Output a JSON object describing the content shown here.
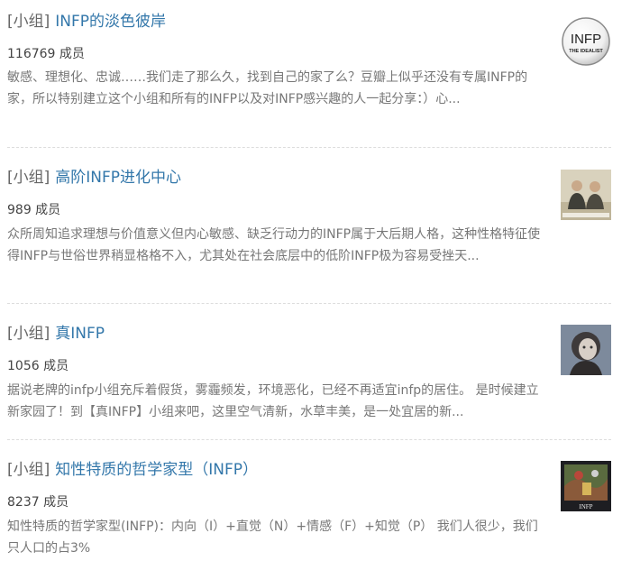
{
  "groups": [
    {
      "tag": "[小组]",
      "name": "INFP的淡色彼岸",
      "members": "116769 成员",
      "description": "敏感、理想化、忠诚……我们走了那么久，找到自己的家了么？豆瓣上似乎还没有专属INFP的家，所以特别建立这个小组和所有的INFP以及对INFP感兴趣的人一起分享：）心...",
      "thumbnail": {
        "icon": "infp-idealist-logo",
        "text_main": "INFP",
        "text_sub": "THE IDEALIST"
      }
    },
    {
      "tag": "[小组]",
      "name": "高阶INFP进化中心",
      "members": "989 成员",
      "description": "众所周知追求理想与价值意义但内心敏感、缺乏行动力的INFP属于大后期人格，这种性格特征使得INFP与世俗世界稍显格格不入，尤其处在社会底层中的低阶INFP极为容易受挫天...",
      "thumbnail": {
        "icon": "two-men-photo"
      }
    },
    {
      "tag": "[小组]",
      "name": "真INFP",
      "members": "1056 成员",
      "description": "据说老牌的infp小组充斥着假货，雾霾频发，环境恶化，已经不再适宜infp的居住。 是时候建立新家园了！到【真INFP】小组来吧，这里空气清新，水草丰美，是一处宜居的新...",
      "thumbnail": {
        "icon": "girl-portrait-photo"
      }
    },
    {
      "tag": "[小组]",
      "name": "知性特质的哲学家型（INFP）",
      "members": "8237 成员",
      "description": "知性特质的哲学家型(INFP)：内向（I）+直觉（N）+情感（F）+知觉（P） 我们人很少，我们只人口的占3%",
      "thumbnail": {
        "icon": "painting-infp-card",
        "caption": "INFP"
      }
    }
  ]
}
